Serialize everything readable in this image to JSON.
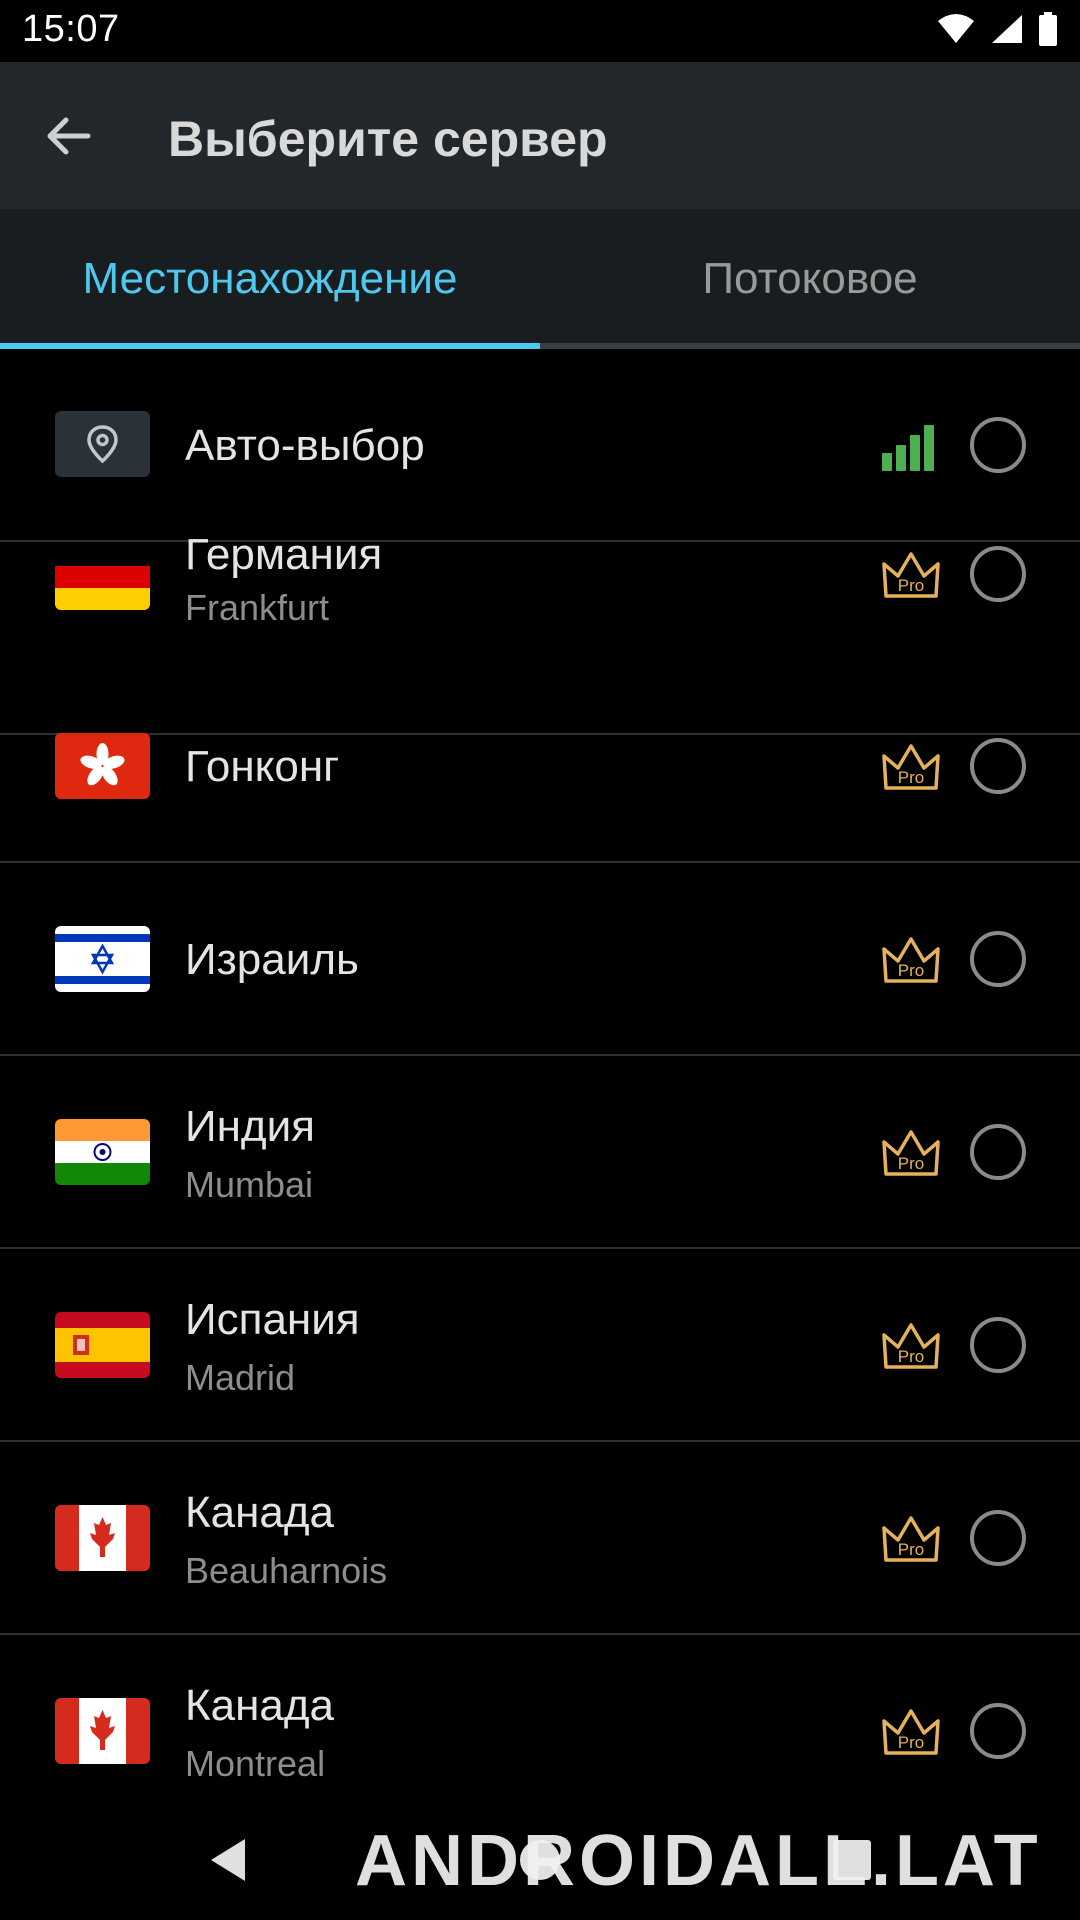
{
  "status": {
    "time": "15:07",
    "icons": [
      "wifi-icon",
      "signal-icon",
      "battery-icon"
    ]
  },
  "app_bar": {
    "title": "Выберите сервер",
    "back_icon": "back-arrow-icon"
  },
  "tabs": [
    {
      "label": "Местонахождение",
      "active": true
    },
    {
      "label": "Потоковое",
      "active": false
    }
  ],
  "colors": {
    "accent": "#4fc8ef",
    "signal_green": "#4caf50",
    "pro_gold": "#e5b15a"
  },
  "auto": {
    "label": "Авто-выбор",
    "icon": "location-pin-icon",
    "status_icon": "signal-bars-icon"
  },
  "servers": [
    {
      "country": "Германия",
      "city": "Frankfurt",
      "flag": "germany-flag",
      "badge": "Pro"
    },
    {
      "country": "Гонконг",
      "city": "",
      "flag": "hong-kong-flag",
      "badge": "Pro"
    },
    {
      "country": "Израиль",
      "city": "",
      "flag": "israel-flag",
      "badge": "Pro"
    },
    {
      "country": "Индия",
      "city": "Mumbai",
      "flag": "india-flag",
      "badge": "Pro"
    },
    {
      "country": "Испания",
      "city": "Madrid",
      "flag": "spain-flag",
      "badge": "Pro"
    },
    {
      "country": "Канада",
      "city": "Beauharnois",
      "flag": "canada-flag",
      "badge": "Pro"
    },
    {
      "country": "Канада",
      "city": "Montreal",
      "flag": "canada-flag",
      "badge": "Pro"
    }
  ],
  "nav": {
    "back": "nav-back-icon",
    "home": "nav-home-icon",
    "recents": "nav-recents-icon"
  },
  "watermark": "ANDROIDALL.LAT"
}
